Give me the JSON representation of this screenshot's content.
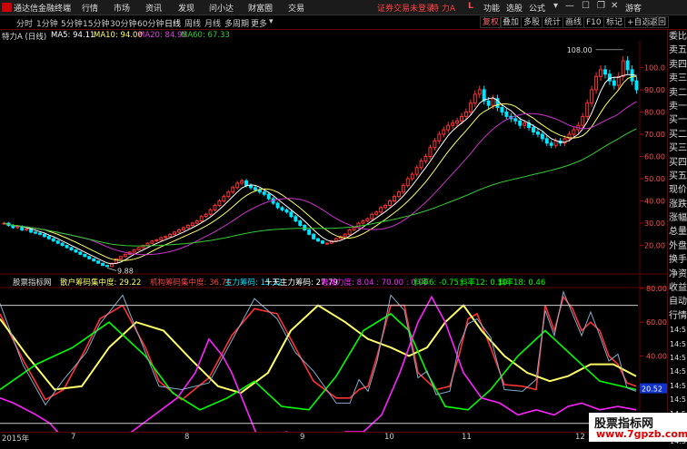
{
  "titlebar": {
    "app_name": "通达信金融终端",
    "menus": [
      "行情",
      "市场",
      "资讯",
      "发现",
      "问小达",
      "财富圈",
      "交易"
    ],
    "warning": "证券交易未登录",
    "stock_name": "特 力A",
    "logo": "L",
    "right_menus": [
      "功能",
      "选股",
      "公式"
    ],
    "user": "游客"
  },
  "toolbar": {
    "periods": [
      "分时",
      "1分钟",
      "5分钟",
      "15分钟",
      "30分钟",
      "60分钟",
      "日线",
      "周线",
      "月线",
      "多周期",
      "更多"
    ],
    "active_period": "日线",
    "right_buttons": [
      "复权",
      "叠加",
      "多股",
      "统计",
      "画线",
      "F10",
      "标记",
      "+自选",
      "返回"
    ]
  },
  "infobar": {
    "title": "特力A (日线)",
    "ma5": "MA5: 94.11",
    "ma10": "MA10: 94.00",
    "ma20": "MA20: 84.95",
    "ma60": "MA60: 67.33"
  },
  "price_axis": {
    "labels": [
      "100.0",
      "90.00",
      "80.00",
      "70.00",
      "60.00",
      "50.00",
      "40.00",
      "30.00",
      "20.00"
    ]
  },
  "annotations": {
    "high": "108.00",
    "low": "9.88"
  },
  "indicator": {
    "name": "股票指标网",
    "retail": "散户筹码集中度: 29.22",
    "inst": "机构筹码集中度: 36.76",
    "main": "主力筹码: 15.12",
    "ten": "十天主力筹码: 27.79",
    "incdec": "增减力度: 8.04 : 70.00 : 0.00",
    "slope6": "斜率6: -0.75",
    "slope12": "斜率12: 0.10",
    "slope18": "斜率18: 0.46",
    "axis": [
      "80.00",
      "60.00",
      "40.00",
      "20.00",
      "0.00"
    ],
    "current_value": "20.52",
    "ref_lines": [
      70,
      0
    ]
  },
  "sidebar": {
    "items": [
      "委比",
      "卖五",
      "卖四",
      "卖三",
      "卖二",
      "卖一",
      "买一",
      "买二",
      "买三",
      "买四",
      "买五",
      "现价",
      "涨跌",
      "涨幅",
      "总量",
      "外盘",
      "换手",
      "净资",
      "收益",
      "自动",
      "行情"
    ],
    "times": [
      "14:5",
      "14:5",
      "14:5",
      "14:5",
      "14:5",
      "14:5",
      "14:5",
      "14:5",
      "14:5"
    ]
  },
  "time_axis": [
    "2015年",
    "7",
    "8",
    "9",
    "10",
    "11",
    "12"
  ],
  "watermark": {
    "line1": "股票指标网",
    "line2": "www.7gpzb.com"
  },
  "colors": {
    "up": "#ff3333",
    "down": "#00e5ff",
    "ma5": "#ffffff",
    "ma10": "#ffff66",
    "ma20": "#cc33cc",
    "ma60": "#33cc33",
    "frame": "#660000"
  },
  "chart_data": [
    {
      "type": "candlestick",
      "title": "特力A (日线)",
      "ylim": [
        8,
        112
      ],
      "ticks": [
        100,
        90,
        80,
        70,
        60,
        50,
        40,
        30,
        20
      ],
      "high": 108.0,
      "low": 9.88,
      "close": [
        30,
        29,
        28,
        28.5,
        27,
        27.5,
        26,
        25.5,
        25,
        24,
        23,
        22,
        21,
        20,
        19,
        18,
        17,
        16,
        15,
        14,
        13,
        12,
        11,
        10.5,
        12,
        14,
        15,
        16,
        17,
        18,
        19,
        20,
        21,
        22,
        22.5,
        23.5,
        24,
        25,
        26,
        27,
        28,
        29,
        30,
        31,
        33,
        34,
        36,
        38,
        40,
        42,
        44,
        46,
        48,
        49,
        47,
        46,
        45,
        44,
        43,
        41,
        39,
        37,
        36,
        35,
        33,
        31,
        29,
        27,
        25,
        23,
        22,
        21,
        21,
        22,
        23,
        24,
        25,
        27,
        28,
        30,
        31,
        32,
        34,
        35,
        37,
        38,
        40,
        42,
        44,
        47,
        50,
        52,
        55,
        58,
        60,
        64,
        67,
        70,
        72,
        74,
        75,
        76,
        78,
        80,
        84,
        88,
        90,
        85,
        83,
        86,
        82,
        80,
        78,
        77,
        76,
        74,
        75,
        73,
        71,
        70,
        68,
        66,
        65,
        67,
        66,
        68,
        70,
        72,
        74,
        78,
        84,
        90,
        96,
        99,
        97,
        94,
        92,
        96,
        103,
        99,
        94,
        90
      ],
      "ma_series": [
        {
          "name": "MA5",
          "value": 94.11
        },
        {
          "name": "MA10",
          "value": 94.0
        },
        {
          "name": "MA20",
          "value": 84.95
        },
        {
          "name": "MA60",
          "value": 67.33
        }
      ]
    },
    {
      "type": "line",
      "title": "股票指标网",
      "ylim": [
        -5,
        80
      ],
      "ticks": [
        80,
        60,
        40,
        20,
        0
      ],
      "series": [
        {
          "name": "散户筹码集中度",
          "color": "#ff3333",
          "anchors": [
            [
              0,
              65
            ],
            [
              25,
              38
            ],
            [
              50,
              14
            ],
            [
              70,
              20
            ],
            [
              95,
              45
            ],
            [
              110,
              62
            ],
            [
              135,
              70
            ],
            [
              160,
              45
            ],
            [
              175,
              25
            ],
            [
              200,
              14
            ],
            [
              230,
              27
            ],
            [
              255,
              52
            ],
            [
              280,
              68
            ],
            [
              305,
              65
            ],
            [
              325,
              45
            ],
            [
              345,
              25
            ],
            [
              370,
              15
            ],
            [
              385,
              15
            ],
            [
              395,
              20
            ],
            [
              405,
              22
            ],
            [
              415,
              40
            ],
            [
              430,
              70
            ],
            [
              445,
              70
            ],
            [
              460,
              30
            ],
            [
              470,
              25
            ],
            [
              480,
              20
            ],
            [
              495,
              22
            ],
            [
              505,
              40
            ],
            [
              515,
              62
            ],
            [
              525,
              65
            ],
            [
              540,
              45
            ],
            [
              555,
              23
            ],
            [
              575,
              22
            ],
            [
              590,
              20
            ],
            [
              600,
              70
            ],
            [
              610,
              55
            ],
            [
              620,
              75
            ],
            [
              630,
              68
            ],
            [
              640,
              55
            ],
            [
              650,
              60
            ],
            [
              660,
              55
            ],
            [
              670,
              40
            ],
            [
              680,
              35
            ],
            [
              690,
              24
            ],
            [
              700,
              22
            ]
          ],
          "value": 29.22
        },
        {
          "name": "机构筹码集中度",
          "color": "#ffff66",
          "anchors": [
            [
              0,
              62
            ],
            [
              30,
              40
            ],
            [
              60,
              20
            ],
            [
              90,
              22
            ],
            [
              120,
              45
            ],
            [
              150,
              60
            ],
            [
              180,
              55
            ],
            [
              210,
              38
            ],
            [
              240,
              22
            ],
            [
              265,
              18
            ],
            [
              295,
              30
            ],
            [
              320,
              55
            ],
            [
              350,
              70
            ],
            [
              380,
              60
            ],
            [
              405,
              50
            ],
            [
              430,
              45
            ],
            [
              450,
              40
            ],
            [
              470,
              45
            ],
            [
              490,
              60
            ],
            [
              510,
              70
            ],
            [
              530,
              55
            ],
            [
              555,
              40
            ],
            [
              580,
              30
            ],
            [
              605,
              25
            ],
            [
              625,
              28
            ],
            [
              650,
              35
            ],
            [
              675,
              35
            ],
            [
              700,
              28
            ]
          ],
          "value": 36.76
        },
        {
          "name": "主力筹码",
          "color": "#00ff00",
          "anchors": [
            [
              0,
              20
            ],
            [
              40,
              35
            ],
            [
              80,
              45
            ],
            [
              120,
              60
            ],
            [
              160,
              40
            ],
            [
              190,
              18
            ],
            [
              220,
              8
            ],
            [
              250,
              15
            ],
            [
              280,
              25
            ],
            [
              310,
              10
            ],
            [
              340,
              8
            ],
            [
              370,
              28
            ],
            [
              400,
              55
            ],
            [
              430,
              65
            ],
            [
              450,
              55
            ],
            [
              470,
              30
            ],
            [
              490,
              10
            ],
            [
              515,
              8
            ],
            [
              540,
              20
            ],
            [
              570,
              40
            ],
            [
              600,
              55
            ],
            [
              630,
              40
            ],
            [
              660,
              25
            ],
            [
              700,
              20
            ]
          ],
          "value": 15.12
        },
        {
          "name": "十天主力筹码",
          "color": "#ff22ff",
          "anchors": [
            [
              0,
              15
            ],
            [
              15,
              12
            ],
            [
              40,
              5
            ],
            [
              55,
              0
            ],
            [
              80,
              -15
            ],
            [
              100,
              -20
            ],
            [
              110,
              -15
            ],
            [
              125,
              -10
            ],
            [
              145,
              -5
            ],
            [
              170,
              5
            ],
            [
              195,
              15
            ],
            [
              215,
              30
            ],
            [
              230,
              50
            ],
            [
              245,
              40
            ],
            [
              255,
              30
            ],
            [
              270,
              10
            ],
            [
              285,
              -10
            ],
            [
              300,
              -12
            ],
            [
              315,
              -5
            ],
            [
              330,
              -8
            ],
            [
              345,
              -15
            ],
            [
              360,
              -12
            ],
            [
              380,
              -5
            ],
            [
              400,
              -5
            ],
            [
              420,
              5
            ],
            [
              440,
              30
            ],
            [
              460,
              60
            ],
            [
              475,
              75
            ],
            [
              490,
              60
            ],
            [
              510,
              30
            ],
            [
              530,
              15
            ],
            [
              550,
              12
            ],
            [
              570,
              5
            ],
            [
              590,
              8
            ],
            [
              610,
              5
            ],
            [
              625,
              10
            ],
            [
              640,
              12
            ],
            [
              660,
              8
            ],
            [
              680,
              10
            ],
            [
              700,
              8
            ]
          ],
          "value": 27.79
        }
      ]
    }
  ]
}
